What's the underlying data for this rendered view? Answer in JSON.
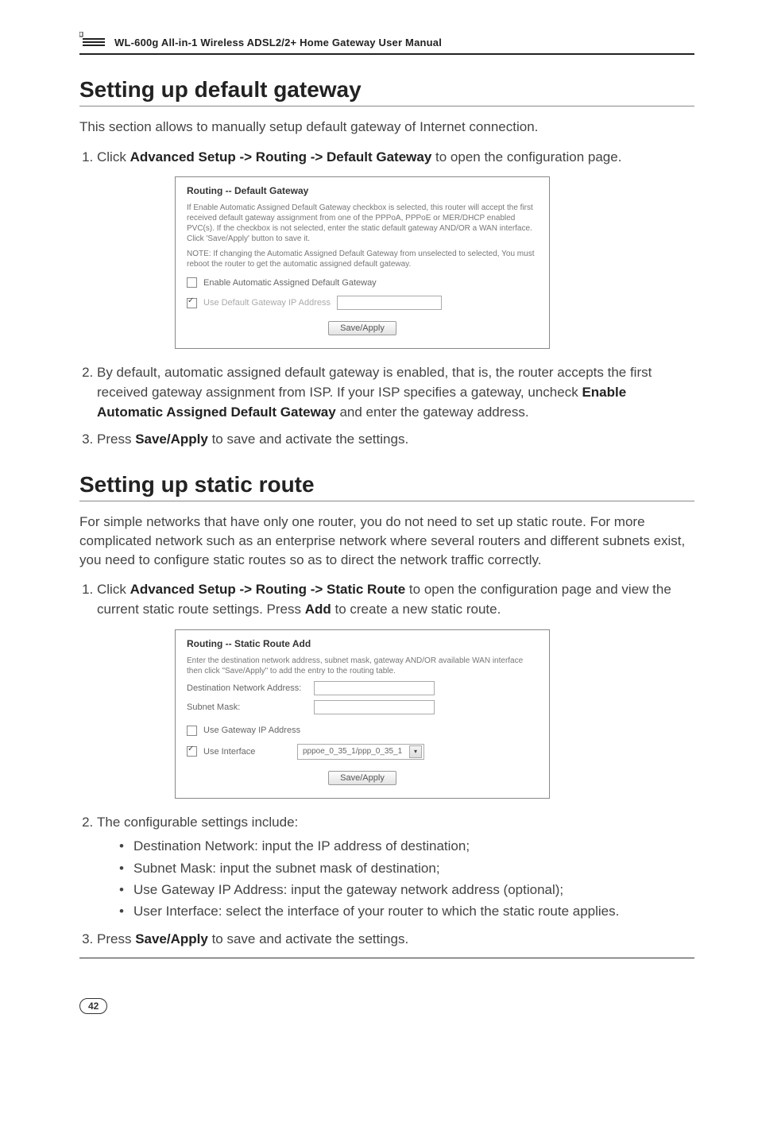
{
  "header": "WL-600g All-in-1 Wireless ADSL2/2+ Home Gateway User Manual",
  "section1": {
    "title": "Setting up default gateway",
    "intro": "This section allows to manually setup default gateway of Internet connection.",
    "step1_pre": "Click ",
    "step1_bold": "Advanced Setup -> Routing -> Default Gateway",
    "step1_post": " to open the configuration page.",
    "ss": {
      "title": "Routing -- Default Gateway",
      "para1": "If Enable Automatic Assigned Default Gateway checkbox is selected, this router will accept the first received default gateway assignment from one of the PPPoA, PPPoE or MER/DHCP enabled PVC(s). If the checkbox is not selected, enter the static default gateway AND/OR a WAN interface. Click 'Save/Apply' button to save it.",
      "para2": "NOTE: If changing the Automatic Assigned Default Gateway from unselected to selected, You must reboot the router to get the automatic assigned default gateway.",
      "chk_enable": "Enable Automatic Assigned Default Gateway",
      "chk_use": "Use Default Gateway IP Address",
      "btn": "Save/Apply"
    },
    "step2_pre": "By default, automatic assigned default gateway is enabled, that is, the router accepts the first received gateway assignment from ISP. If your ISP specifies a gateway, uncheck ",
    "step2_bold": "Enable Automatic Assigned Default Gateway",
    "step2_post": " and enter the gateway address.",
    "step3_pre": "Press ",
    "step3_bold": "Save/Apply",
    "step3_post": " to save and activate the settings."
  },
  "section2": {
    "title": "Setting up static route",
    "intro": "For simple networks that have only one router, you do not need to set up static route. For more complicated network such as an enterprise network where several routers and different subnets exist, you need to configure static routes so as to direct the network traffic correctly.",
    "step1_pre": "Click ",
    "step1_bold": "Advanced Setup -> Routing -> Static Route",
    "step1_mid": " to open the configuration page and view the current static route settings. Press ",
    "step1_bold2": "Add",
    "step1_post": " to create a new static route.",
    "ss": {
      "title": "Routing -- Static Route Add",
      "para": "Enter the destination network address, subnet mask, gateway AND/OR available WAN interface then click \"Save/Apply\" to add the entry to the routing table.",
      "lbl_dest": "Destination Network Address:",
      "lbl_mask": "Subnet Mask:",
      "chk_gw": "Use Gateway IP Address",
      "chk_if": "Use Interface",
      "if_value": "pppoe_0_35_1/ppp_0_35_1",
      "btn": "Save/Apply"
    },
    "step2": "The configurable settings include:",
    "b1": "Destination Network: input the IP address of destination;",
    "b2": "Subnet Mask: input the subnet mask of destination;",
    "b3": "Use Gateway IP Address: input the gateway network address (optional);",
    "b4": "User Interface: select the interface of your router to which the static route applies.",
    "step3_pre": "Press ",
    "step3_bold": "Save/Apply",
    "step3_post": " to save and activate the settings."
  },
  "page_number": "42"
}
